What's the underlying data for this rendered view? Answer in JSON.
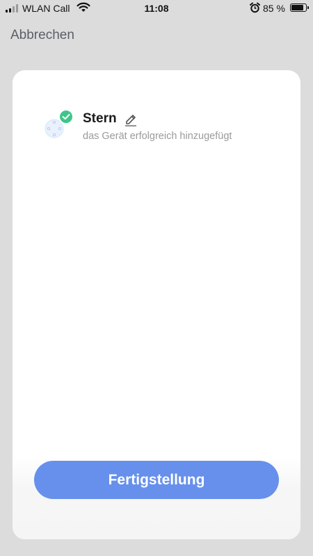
{
  "status_bar": {
    "carrier": "WLAN Call",
    "time": "11:08",
    "battery_percent": "85 %",
    "battery_level": 0.85,
    "icons": [
      "signal-icon",
      "wifi-icon",
      "alarm-icon",
      "battery-icon"
    ]
  },
  "header": {
    "cancel_label": "Abbrechen"
  },
  "device": {
    "name": "Stern",
    "status": "das Gerät erfolgreich hinzugefügt",
    "icons": [
      "device-image-icon",
      "check-icon",
      "edit-pencil-icon"
    ]
  },
  "footer": {
    "finish_label": "Fertigstellung"
  },
  "colors": {
    "background": "#dcdcdc",
    "card": "#ffffff",
    "accent_button": "#6690ec",
    "success_badge": "#3fc58c",
    "secondary_text": "#9a9a9a"
  }
}
